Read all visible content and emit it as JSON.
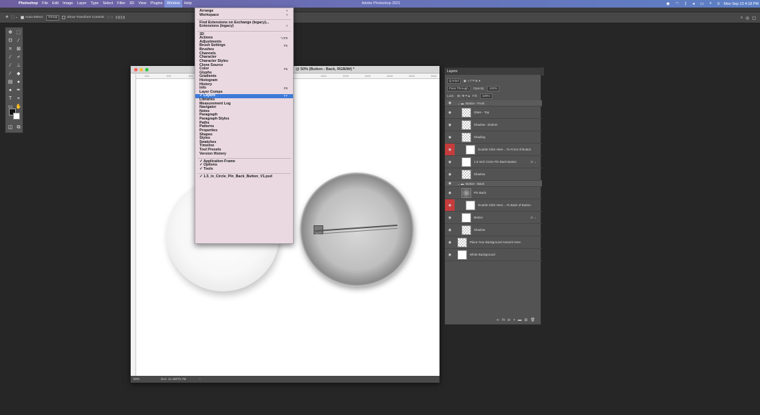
{
  "menubar": {
    "app": "Photoshop",
    "items": [
      "File",
      "Edit",
      "Image",
      "Layer",
      "Type",
      "Select",
      "Filter",
      "3D",
      "View",
      "Plugins",
      "Window",
      "Help"
    ],
    "active": "Window",
    "center_title": "Adobe Photoshop 2021",
    "clock": "Mon Sep 13  4:18 PM"
  },
  "options": {
    "auto_select_label": "Auto-Select:",
    "auto_select_value": "Group",
    "show_transform": "Show Transform Controls"
  },
  "document": {
    "title": "@ 50% (Button - Back, RGB/8#) *",
    "ruler_ticks": [
      "100",
      "200",
      "300",
      "1100",
      "1200",
      "1300",
      "1400",
      "1500",
      "1600",
      "1700",
      "1800",
      "1900"
    ],
    "zoom": "50%",
    "doc_size": "Doc: 11.4M/75.7M"
  },
  "window_menu": {
    "items": [
      {
        "label": "Arrange",
        "arrow": "›"
      },
      {
        "label": "Workspace",
        "arrow": "›"
      },
      {
        "sep": true
      },
      {
        "label": "Find Extensions on Exchange (legacy)..."
      },
      {
        "label": "Extensions (legacy)",
        "arrow": "›"
      },
      {
        "sep": true
      },
      {
        "label": "3D"
      },
      {
        "label": "Actions",
        "shortcut": "⌥F9"
      },
      {
        "label": "Adjustments"
      },
      {
        "label": "Brush Settings",
        "shortcut": "F5"
      },
      {
        "label": "Brushes"
      },
      {
        "label": "Channels"
      },
      {
        "label": "Character"
      },
      {
        "label": "Character Styles"
      },
      {
        "label": "Clone Source"
      },
      {
        "label": "Color",
        "shortcut": "F6"
      },
      {
        "label": "Glyphs"
      },
      {
        "label": "Gradients"
      },
      {
        "label": "Histogram"
      },
      {
        "label": "History"
      },
      {
        "label": "Info",
        "shortcut": "F8"
      },
      {
        "label": "Layer Comps"
      },
      {
        "label": "✓ Layers",
        "shortcut": "F7",
        "selected": true
      },
      {
        "label": "Libraries"
      },
      {
        "label": "Measurement Log"
      },
      {
        "label": "Navigator"
      },
      {
        "label": "Notes"
      },
      {
        "label": "Paragraph"
      },
      {
        "label": "Paragraph Styles"
      },
      {
        "label": "Paths"
      },
      {
        "label": "Patterns"
      },
      {
        "label": "Properties"
      },
      {
        "label": "Shapes"
      },
      {
        "label": "Styles"
      },
      {
        "label": "Swatches"
      },
      {
        "label": "Timeline"
      },
      {
        "label": "Tool Presets"
      },
      {
        "label": "Version History"
      },
      {
        "sep": true
      },
      {
        "label": "✓ Application Frame"
      },
      {
        "label": "✓ Options"
      },
      {
        "label": "✓ Tools"
      },
      {
        "sep": true
      },
      {
        "label": "✓ 1.5_in_Circle_Pin_Back_Button_V1.psd"
      }
    ]
  },
  "layers_panel": {
    "tab": "Layers",
    "kind": "Q Kind",
    "blend_mode": "Pass Through",
    "opacity_label": "Opacity:",
    "opacity": "100%",
    "lock_label": "Lock:",
    "fill_label": "Fill:",
    "fill": "100%",
    "layers": [
      {
        "name": "Button - Front",
        "group": true,
        "indent": 0,
        "eye_red": false
      },
      {
        "name": "Glare - Top",
        "indent": 1,
        "thumb": "checker",
        "eye_red": false
      },
      {
        "name": "Shadow - Bottom",
        "indent": 1,
        "thumb": "checker",
        "eye_red": false
      },
      {
        "name": "Shading",
        "indent": 1,
        "thumb": "checker",
        "eye_red": false
      },
      {
        "name": "Double-Click Here ...To Front of Button",
        "indent": 2,
        "thumb": "white",
        "eye_red": true
      },
      {
        "name": "1.5 Inch Circle Pin Back Button",
        "indent": 1,
        "thumb": "white",
        "eye_red": false,
        "link": true
      },
      {
        "name": "Shadow",
        "indent": 1,
        "thumb": "checker",
        "eye_red": false
      },
      {
        "name": "Button - Back",
        "group": true,
        "indent": 0,
        "eye_red": false
      },
      {
        "name": "Pin Back",
        "indent": 1,
        "thumb": "pin",
        "eye_red": false
      },
      {
        "name": "Double-Click Here ...To Back of Button",
        "indent": 2,
        "thumb": "white",
        "eye_red": true
      },
      {
        "name": "Button",
        "indent": 1,
        "thumb": "white",
        "eye_red": false,
        "link": true
      },
      {
        "name": "Shadow",
        "indent": 1,
        "thumb": "checker",
        "eye_red": false
      },
      {
        "name": "Place Your Background Artwork Here",
        "indent": 0,
        "thumb": "checker",
        "eye_red": false
      },
      {
        "name": "White Background",
        "indent": 0,
        "thumb": "white",
        "eye_red": false
      }
    ],
    "footer_icons": [
      "link-icon",
      "fx-icon",
      "mask-icon",
      "adjustment-icon",
      "folder-icon",
      "new-layer-icon",
      "trash-icon"
    ]
  },
  "colors": {
    "menubar": "#6a6fb6",
    "selection": "#3d7ad8",
    "eye_red": "#c53c3c",
    "canvas": "#ffffff",
    "panel": "#535353"
  }
}
